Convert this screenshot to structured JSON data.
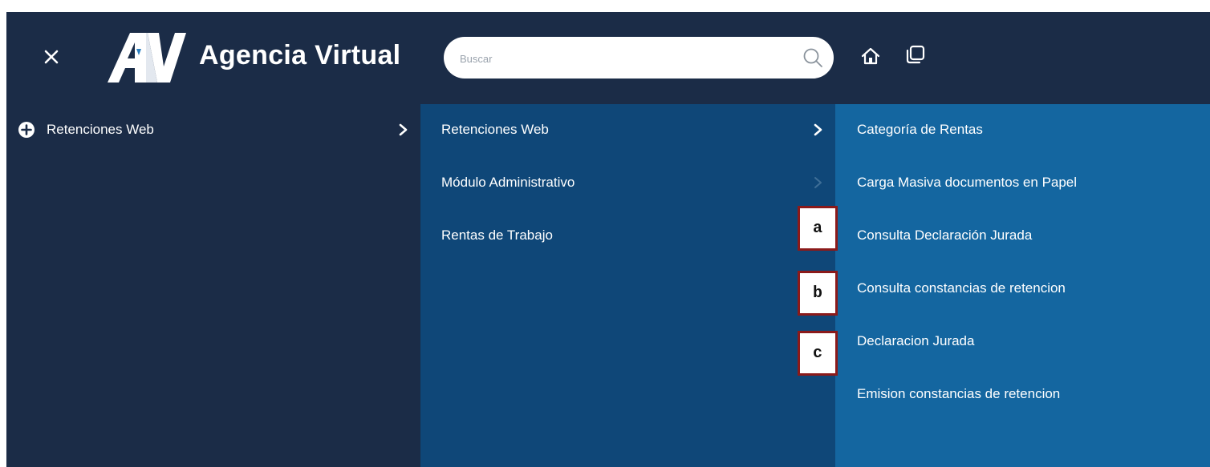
{
  "header": {
    "brand": "Agencia Virtual",
    "search_placeholder": "Buscar",
    "icons": {
      "close": "close-icon",
      "logo": "av-logo",
      "search": "search-icon",
      "home": "home-icon",
      "windows": "windows-icon"
    }
  },
  "menu": {
    "level1": [
      {
        "label": "Retenciones Web",
        "icon": "plus-circle-icon"
      }
    ],
    "level2": [
      {
        "label": "Retenciones Web"
      },
      {
        "label": "Módulo Administrativo"
      },
      {
        "label": "Rentas de Trabajo"
      }
    ],
    "level3": [
      {
        "label": "Categoría de Rentas"
      },
      {
        "label": "Carga Masiva documentos en Papel"
      },
      {
        "label": "Consulta Declaración Jurada"
      },
      {
        "label": "Consulta constancias de retencion"
      },
      {
        "label": "Declaracion Jurada"
      },
      {
        "label": "Emision constancias de retencion"
      }
    ]
  },
  "markers": [
    {
      "label": "a"
    },
    {
      "label": "b"
    },
    {
      "label": "c"
    }
  ],
  "colors": {
    "header_bg": "#1b2c47",
    "column1_bg": "#1b2c47",
    "column2_bg": "#0f4778",
    "column3_bg": "#1466a0",
    "marker_border": "#8b1a1a"
  }
}
